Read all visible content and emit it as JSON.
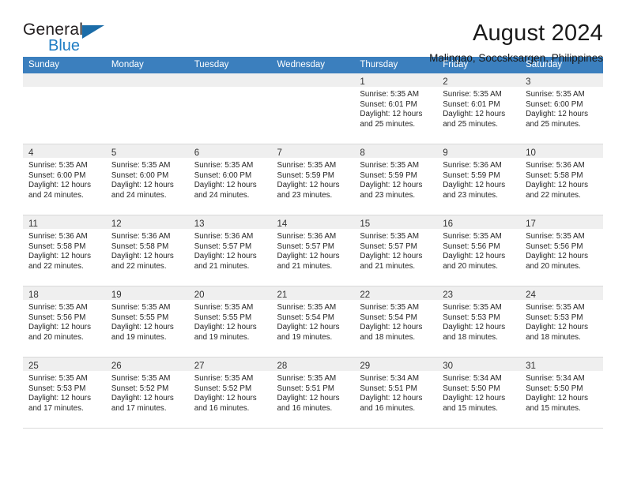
{
  "logo": {
    "word_top": "General",
    "word_bottom": "Blue",
    "triangle_color": "#1b6ca8",
    "blue_text_color": "#1f7dc4"
  },
  "header": {
    "title": "August 2024",
    "subtitle": "Malingao, Soccsksargen, Philippines"
  },
  "theme": {
    "header_blue": "#3b7fbe",
    "daynum_band": "#efefef",
    "row_divider": "#d9d9d9"
  },
  "weekdays": [
    "Sunday",
    "Monday",
    "Tuesday",
    "Wednesday",
    "Thursday",
    "Friday",
    "Saturday"
  ],
  "weeks": [
    [
      {
        "day": "",
        "sunrise": "",
        "sunset": "",
        "daylight1": "",
        "daylight2": ""
      },
      {
        "day": "",
        "sunrise": "",
        "sunset": "",
        "daylight1": "",
        "daylight2": ""
      },
      {
        "day": "",
        "sunrise": "",
        "sunset": "",
        "daylight1": "",
        "daylight2": ""
      },
      {
        "day": "",
        "sunrise": "",
        "sunset": "",
        "daylight1": "",
        "daylight2": ""
      },
      {
        "day": "1",
        "sunrise": "Sunrise: 5:35 AM",
        "sunset": "Sunset: 6:01 PM",
        "daylight1": "Daylight: 12 hours",
        "daylight2": "and 25 minutes."
      },
      {
        "day": "2",
        "sunrise": "Sunrise: 5:35 AM",
        "sunset": "Sunset: 6:01 PM",
        "daylight1": "Daylight: 12 hours",
        "daylight2": "and 25 minutes."
      },
      {
        "day": "3",
        "sunrise": "Sunrise: 5:35 AM",
        "sunset": "Sunset: 6:00 PM",
        "daylight1": "Daylight: 12 hours",
        "daylight2": "and 25 minutes."
      }
    ],
    [
      {
        "day": "4",
        "sunrise": "Sunrise: 5:35 AM",
        "sunset": "Sunset: 6:00 PM",
        "daylight1": "Daylight: 12 hours",
        "daylight2": "and 24 minutes."
      },
      {
        "day": "5",
        "sunrise": "Sunrise: 5:35 AM",
        "sunset": "Sunset: 6:00 PM",
        "daylight1": "Daylight: 12 hours",
        "daylight2": "and 24 minutes."
      },
      {
        "day": "6",
        "sunrise": "Sunrise: 5:35 AM",
        "sunset": "Sunset: 6:00 PM",
        "daylight1": "Daylight: 12 hours",
        "daylight2": "and 24 minutes."
      },
      {
        "day": "7",
        "sunrise": "Sunrise: 5:35 AM",
        "sunset": "Sunset: 5:59 PM",
        "daylight1": "Daylight: 12 hours",
        "daylight2": "and 23 minutes."
      },
      {
        "day": "8",
        "sunrise": "Sunrise: 5:35 AM",
        "sunset": "Sunset: 5:59 PM",
        "daylight1": "Daylight: 12 hours",
        "daylight2": "and 23 minutes."
      },
      {
        "day": "9",
        "sunrise": "Sunrise: 5:36 AM",
        "sunset": "Sunset: 5:59 PM",
        "daylight1": "Daylight: 12 hours",
        "daylight2": "and 23 minutes."
      },
      {
        "day": "10",
        "sunrise": "Sunrise: 5:36 AM",
        "sunset": "Sunset: 5:58 PM",
        "daylight1": "Daylight: 12 hours",
        "daylight2": "and 22 minutes."
      }
    ],
    [
      {
        "day": "11",
        "sunrise": "Sunrise: 5:36 AM",
        "sunset": "Sunset: 5:58 PM",
        "daylight1": "Daylight: 12 hours",
        "daylight2": "and 22 minutes."
      },
      {
        "day": "12",
        "sunrise": "Sunrise: 5:36 AM",
        "sunset": "Sunset: 5:58 PM",
        "daylight1": "Daylight: 12 hours",
        "daylight2": "and 22 minutes."
      },
      {
        "day": "13",
        "sunrise": "Sunrise: 5:36 AM",
        "sunset": "Sunset: 5:57 PM",
        "daylight1": "Daylight: 12 hours",
        "daylight2": "and 21 minutes."
      },
      {
        "day": "14",
        "sunrise": "Sunrise: 5:36 AM",
        "sunset": "Sunset: 5:57 PM",
        "daylight1": "Daylight: 12 hours",
        "daylight2": "and 21 minutes."
      },
      {
        "day": "15",
        "sunrise": "Sunrise: 5:35 AM",
        "sunset": "Sunset: 5:57 PM",
        "daylight1": "Daylight: 12 hours",
        "daylight2": "and 21 minutes."
      },
      {
        "day": "16",
        "sunrise": "Sunrise: 5:35 AM",
        "sunset": "Sunset: 5:56 PM",
        "daylight1": "Daylight: 12 hours",
        "daylight2": "and 20 minutes."
      },
      {
        "day": "17",
        "sunrise": "Sunrise: 5:35 AM",
        "sunset": "Sunset: 5:56 PM",
        "daylight1": "Daylight: 12 hours",
        "daylight2": "and 20 minutes."
      }
    ],
    [
      {
        "day": "18",
        "sunrise": "Sunrise: 5:35 AM",
        "sunset": "Sunset: 5:56 PM",
        "daylight1": "Daylight: 12 hours",
        "daylight2": "and 20 minutes."
      },
      {
        "day": "19",
        "sunrise": "Sunrise: 5:35 AM",
        "sunset": "Sunset: 5:55 PM",
        "daylight1": "Daylight: 12 hours",
        "daylight2": "and 19 minutes."
      },
      {
        "day": "20",
        "sunrise": "Sunrise: 5:35 AM",
        "sunset": "Sunset: 5:55 PM",
        "daylight1": "Daylight: 12 hours",
        "daylight2": "and 19 minutes."
      },
      {
        "day": "21",
        "sunrise": "Sunrise: 5:35 AM",
        "sunset": "Sunset: 5:54 PM",
        "daylight1": "Daylight: 12 hours",
        "daylight2": "and 19 minutes."
      },
      {
        "day": "22",
        "sunrise": "Sunrise: 5:35 AM",
        "sunset": "Sunset: 5:54 PM",
        "daylight1": "Daylight: 12 hours",
        "daylight2": "and 18 minutes."
      },
      {
        "day": "23",
        "sunrise": "Sunrise: 5:35 AM",
        "sunset": "Sunset: 5:53 PM",
        "daylight1": "Daylight: 12 hours",
        "daylight2": "and 18 minutes."
      },
      {
        "day": "24",
        "sunrise": "Sunrise: 5:35 AM",
        "sunset": "Sunset: 5:53 PM",
        "daylight1": "Daylight: 12 hours",
        "daylight2": "and 18 minutes."
      }
    ],
    [
      {
        "day": "25",
        "sunrise": "Sunrise: 5:35 AM",
        "sunset": "Sunset: 5:53 PM",
        "daylight1": "Daylight: 12 hours",
        "daylight2": "and 17 minutes."
      },
      {
        "day": "26",
        "sunrise": "Sunrise: 5:35 AM",
        "sunset": "Sunset: 5:52 PM",
        "daylight1": "Daylight: 12 hours",
        "daylight2": "and 17 minutes."
      },
      {
        "day": "27",
        "sunrise": "Sunrise: 5:35 AM",
        "sunset": "Sunset: 5:52 PM",
        "daylight1": "Daylight: 12 hours",
        "daylight2": "and 16 minutes."
      },
      {
        "day": "28",
        "sunrise": "Sunrise: 5:35 AM",
        "sunset": "Sunset: 5:51 PM",
        "daylight1": "Daylight: 12 hours",
        "daylight2": "and 16 minutes."
      },
      {
        "day": "29",
        "sunrise": "Sunrise: 5:34 AM",
        "sunset": "Sunset: 5:51 PM",
        "daylight1": "Daylight: 12 hours",
        "daylight2": "and 16 minutes."
      },
      {
        "day": "30",
        "sunrise": "Sunrise: 5:34 AM",
        "sunset": "Sunset: 5:50 PM",
        "daylight1": "Daylight: 12 hours",
        "daylight2": "and 15 minutes."
      },
      {
        "day": "31",
        "sunrise": "Sunrise: 5:34 AM",
        "sunset": "Sunset: 5:50 PM",
        "daylight1": "Daylight: 12 hours",
        "daylight2": "and 15 minutes."
      }
    ]
  ]
}
